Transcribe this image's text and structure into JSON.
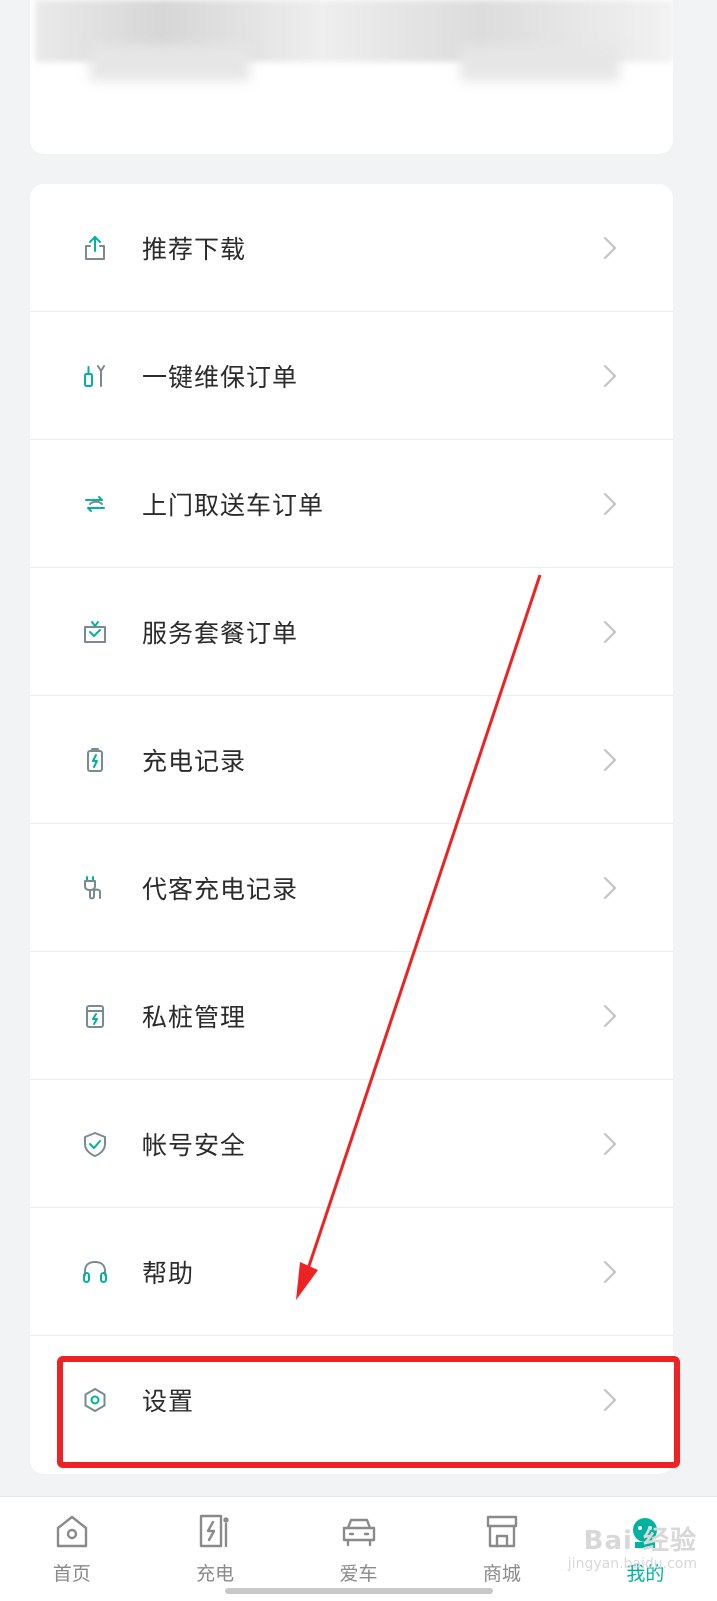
{
  "colors": {
    "accent": "#00b3a0",
    "annotation": "#ee2222",
    "background": "#f2f3f5",
    "label": "#2b2b2b",
    "tab_inactive": "#8a8a8a"
  },
  "menu": {
    "items": [
      {
        "label": "推荐下载",
        "icon": "share-upload-icon"
      },
      {
        "label": "一键维保订单",
        "icon": "maintenance-tools-icon"
      },
      {
        "label": "上门取送车订单",
        "icon": "car-pickup-icon"
      },
      {
        "label": "服务套餐订单",
        "icon": "package-bag-icon"
      },
      {
        "label": "充电记录",
        "icon": "battery-charge-icon"
      },
      {
        "label": "代客充电记录",
        "icon": "plug-cable-icon"
      },
      {
        "label": "私桩管理",
        "icon": "charging-pile-icon"
      },
      {
        "label": "帐号安全",
        "icon": "shield-check-icon"
      },
      {
        "label": "帮助",
        "icon": "headset-icon"
      },
      {
        "label": "设置",
        "icon": "settings-hex-icon"
      }
    ]
  },
  "tabbar": {
    "tabs": [
      {
        "label": "首页",
        "icon": "home-icon",
        "active": false
      },
      {
        "label": "充电",
        "icon": "charger-icon",
        "active": false
      },
      {
        "label": "爱车",
        "icon": "car-icon",
        "active": false
      },
      {
        "label": "商城",
        "icon": "store-icon",
        "active": false
      },
      {
        "label": "我的",
        "icon": "profile-mascot-icon",
        "active": true
      }
    ]
  },
  "watermark": {
    "text": "Bai 经验",
    "sub": "jingyan.baidu.com"
  }
}
